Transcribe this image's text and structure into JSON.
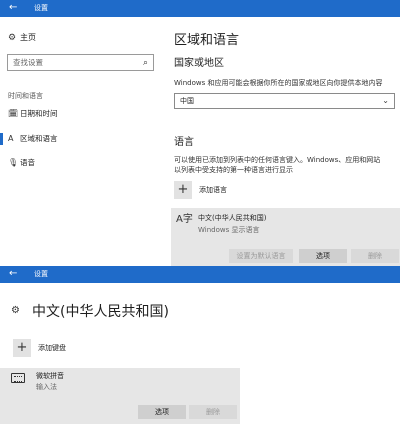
{
  "top": {
    "title": "设置",
    "sidebar": {
      "home": "主页",
      "search_placeholder": "查找设置",
      "group": "时间和语言",
      "items": [
        {
          "label": "日期和时间",
          "icon": "calendar-clock-icon"
        },
        {
          "label": "区域和语言",
          "icon": "region-language-icon",
          "selected": true
        },
        {
          "label": "语音",
          "icon": "microphone-icon"
        }
      ]
    },
    "main": {
      "page_title": "区域和语言",
      "country_heading": "国家或地区",
      "country_desc": "Windows 和应用可能会根据你所在的国家或地区向你提供本地内容",
      "country_value": "中国",
      "lang_heading": "语言",
      "lang_desc_line1": "可以使用已添加到列表中的任何语言键入。Windows、应用和网站",
      "lang_desc_line2": "以列表中受支持的第一种语言进行显示",
      "add_language": "添加语言",
      "language": {
        "name": "中文(中华人民共和国)",
        "subtitle": "Windows 显示语言",
        "btn_default": "设置为默认语言",
        "btn_options": "选项",
        "btn_remove": "删除"
      }
    }
  },
  "bottom": {
    "title": "设置",
    "page_title": "中文(中华人民共和国)",
    "add_keyboard": "添加键盘",
    "keyboard": {
      "name": "微软拼音",
      "subtitle": "输入法",
      "btn_options": "选项",
      "btn_remove": "删除"
    }
  },
  "colors": {
    "titlebar": "#1f6bc9",
    "accent": "#1f6bc9"
  }
}
